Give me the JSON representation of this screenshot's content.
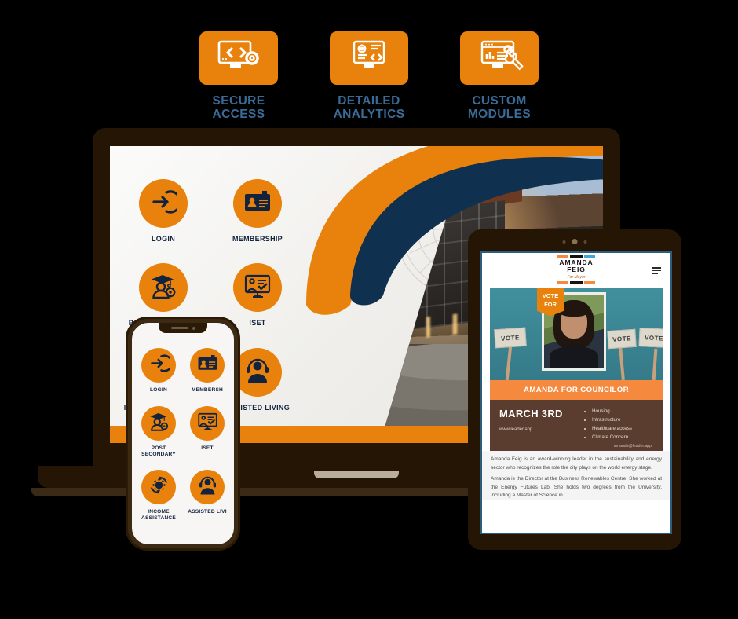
{
  "features": [
    {
      "label_line1": "SECURE",
      "label_line2": "ACCESS",
      "icon": "monitor-code-gear-icon",
      "name": "secure-access"
    },
    {
      "label_line1": "DETAILED",
      "label_line2": "ANALYTICS",
      "icon": "monitor-gear-code-icon",
      "name": "detailed-analytics"
    },
    {
      "label_line1": "CUSTOM",
      "label_line2": "MODULES",
      "icon": "monitor-chart-wrench-icon",
      "name": "custom-modules"
    }
  ],
  "laptop": {
    "apps": [
      {
        "label": "LOGIN",
        "icon": "login-arrow-icon"
      },
      {
        "label": "MEMBERSHIP",
        "icon": "id-card-icon"
      },
      {
        "label": "POST SECONDARY",
        "icon": "graduate-gear-icon"
      },
      {
        "label": "ISET",
        "icon": "training-board-icon"
      },
      {
        "label": "INCOME ASSISTANCE",
        "icon": "gear-refresh-icon"
      },
      {
        "label": "ASSISTED LIVING",
        "icon": "headset-person-icon"
      }
    ],
    "partial_label": "IVING"
  },
  "phone": {
    "apps": [
      {
        "label_line1": "LOGIN",
        "label_line2": "",
        "icon": "login-arrow-icon"
      },
      {
        "label_line1": "MEMBERSH",
        "label_line2": "",
        "icon": "id-card-icon"
      },
      {
        "label_line1": "POST",
        "label_line2": "SECONDARY",
        "icon": "graduate-gear-icon"
      },
      {
        "label_line1": "ISET",
        "label_line2": "",
        "icon": "training-board-icon"
      },
      {
        "label_line1": "INCOME",
        "label_line2": "ASSISTANCE",
        "icon": "gear-refresh-icon"
      },
      {
        "label_line1": "ASSISTED LIVI",
        "label_line2": "",
        "icon": "headset-person-icon"
      }
    ]
  },
  "tablet": {
    "brand_name_line1": "AMANDA",
    "brand_name_line2": "FEIG",
    "brand_tagline": "For Mayor",
    "menu_icon": "hamburger-menu-icon",
    "poster": {
      "vote_for_badge_line1": "VOTE",
      "vote_for_badge_line2": "FOR",
      "vote_sign_text": "VOTE",
      "banner": "AMANDA FOR COUNCILOR",
      "date": "MARCH 3RD",
      "website": "www.leader.app",
      "email": "amanda@leader.app",
      "issues": [
        "Housing",
        "Infrastructure",
        "Healthcare access",
        "Climate Concern"
      ]
    },
    "body_paragraphs": [
      "Amanda Feig is an award-winning leader in the sustainability and energy sector who recognizes the role the city plays on the world energy stage.",
      "Amanda is the Director at the Business Renewables Centre. She worked at the Energy Futures Lab. She holds two degrees from the University, including a Master of Science in"
    ]
  },
  "colors": {
    "orange": "#E8820C",
    "navy": "#12233F",
    "steel_blue": "#3A6A96",
    "teal": "#3E8997",
    "brown": "#5A3D2E",
    "light_orange": "#F58A3F"
  }
}
